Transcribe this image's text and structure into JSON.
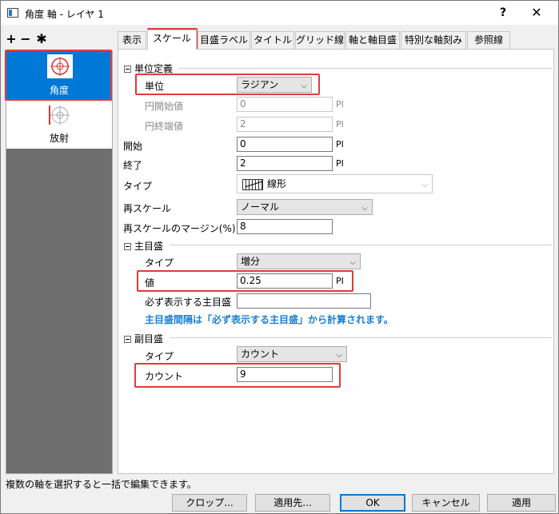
{
  "window": {
    "title": "角度 軸 - レイヤ 1",
    "help_label": "?",
    "close_label": "✕"
  },
  "toolbar": {
    "add_label": "+",
    "remove_label": "−",
    "settings_label": "✱"
  },
  "axes_list": {
    "items": [
      {
        "label": "角度",
        "selected": true
      },
      {
        "label": "放射",
        "selected": false
      }
    ]
  },
  "tabs": [
    {
      "label": "表示",
      "active": false
    },
    {
      "label": "スケール",
      "active": true
    },
    {
      "label": "目盛ラベル",
      "active": false
    },
    {
      "label": "タイトル",
      "active": false
    },
    {
      "label": "グリッド線",
      "active": false
    },
    {
      "label": "軸と軸目盛",
      "active": false
    },
    {
      "label": "特別な軸刻み",
      "active": false
    },
    {
      "label": "参照線",
      "active": false
    }
  ],
  "unit_group": {
    "header": "単位定義",
    "unit_label": "単位",
    "unit_value": "ラジアン",
    "circle_start_label": "円開始値",
    "circle_start_value": "0",
    "circle_start_unit": "PI",
    "circle_end_label": "円終端値",
    "circle_end_value": "2",
    "circle_end_unit": "PI"
  },
  "scale": {
    "start_label": "開始",
    "start_value": "0",
    "start_unit": "PI",
    "end_label": "終了",
    "end_value": "2",
    "end_unit": "PI",
    "type_label": "タイプ",
    "type_value": "線形",
    "rescale_label": "再スケール",
    "rescale_value": "ノーマル",
    "margin_label": "再スケールのマージン(%)",
    "margin_value": "8"
  },
  "major_group": {
    "header": "主目盛",
    "type_label": "タイプ",
    "type_value": "増分",
    "value_label": "値",
    "value_value": "0.25",
    "value_unit": "PI",
    "anchor_label": "必ず表示する主目盛",
    "anchor_value": "",
    "note": "主目盛間隔は「必ず表示する主目盛」から計算されます。"
  },
  "minor_group": {
    "header": "副目盛",
    "type_label": "タイプ",
    "type_value": "カウント",
    "count_label": "カウント",
    "count_value": "9"
  },
  "status_text": "複数の軸を選択すると一括で編集できます。",
  "buttons": {
    "crop": "クロップ...",
    "apply_to": "適用先...",
    "ok": "OK",
    "cancel": "キャンセル",
    "apply": "適用"
  },
  "colors": {
    "accent": "#0078d7",
    "highlight": "#e43a3a",
    "note": "#1a7fd4"
  }
}
